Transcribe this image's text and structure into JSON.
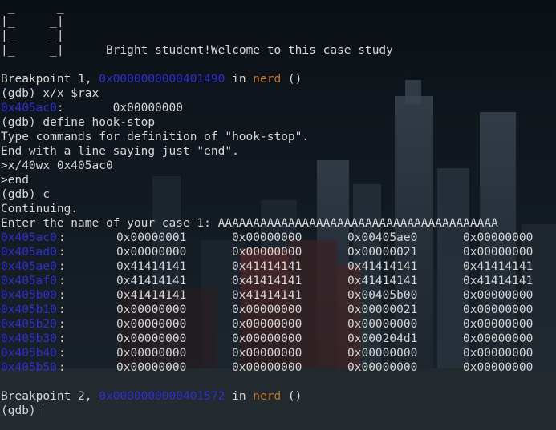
{
  "banner": [
    " _      _",
    "|_     _|",
    "|_     _|",
    "|_     _|"
  ],
  "banner_message": "Bright student!Welcome to this case study",
  "bp1": {
    "prefix": "Breakpoint 1, ",
    "addr": "0x0000000000401490",
    "in": " in ",
    "func": "nerd",
    "suffix": " ()"
  },
  "cmd1": "(gdb) x/x $rax",
  "xrax": {
    "addr": "0x405ac0",
    "value": ":       0x00000000"
  },
  "cmd2": "(gdb) define hook-stop",
  "msg1": "Type commands for definition of \"hook-stop\".",
  "msg2": "End with a line saying just \"end\".",
  "hook_line": ">x/40wx 0x405ac0",
  "end_line": ">end",
  "cmd3": "(gdb) c",
  "continuing": "Continuing.",
  "enter_case": "Enter the name of your case 1: AAAAAAAAAAAAAAAAAAAAAAAAAAAAAAAAAAAAAAAA",
  "memory": [
    {
      "addr": "0x405ac0",
      "words": [
        "0x00000001",
        "0x00000000",
        "0x00405ae0",
        "0x00000000"
      ]
    },
    {
      "addr": "0x405ad0",
      "words": [
        "0x00000000",
        "0x00000000",
        "0x00000021",
        "0x00000000"
      ]
    },
    {
      "addr": "0x405ae0",
      "words": [
        "0x41414141",
        "0x41414141",
        "0x41414141",
        "0x41414141"
      ]
    },
    {
      "addr": "0x405af0",
      "words": [
        "0x41414141",
        "0x41414141",
        "0x41414141",
        "0x41414141"
      ]
    },
    {
      "addr": "0x405b00",
      "words": [
        "0x41414141",
        "0x41414141",
        "0x00405b00",
        "0x00000000"
      ]
    },
    {
      "addr": "0x405b10",
      "words": [
        "0x00000000",
        "0x00000000",
        "0x00000021",
        "0x00000000"
      ]
    },
    {
      "addr": "0x405b20",
      "words": [
        "0x00000000",
        "0x00000000",
        "0x00000000",
        "0x00000000"
      ]
    },
    {
      "addr": "0x405b30",
      "words": [
        "0x00000000",
        "0x00000000",
        "0x000204d1",
        "0x00000000"
      ]
    },
    {
      "addr": "0x405b40",
      "words": [
        "0x00000000",
        "0x00000000",
        "0x00000000",
        "0x00000000"
      ]
    },
    {
      "addr": "0x405b50",
      "words": [
        "0x00000000",
        "0x00000000",
        "0x00000000",
        "0x00000000"
      ]
    }
  ],
  "bp2": {
    "prefix": "Breakpoint 2, ",
    "addr": "0x0000000000401572",
    "in": " in ",
    "func": "nerd",
    "suffix": " ()"
  },
  "prompt": "(gdb) ",
  "colors": {
    "address": "#2f2fcf",
    "function": "#c7731f",
    "text": "#d6d6d6",
    "background": "#0f141b"
  }
}
